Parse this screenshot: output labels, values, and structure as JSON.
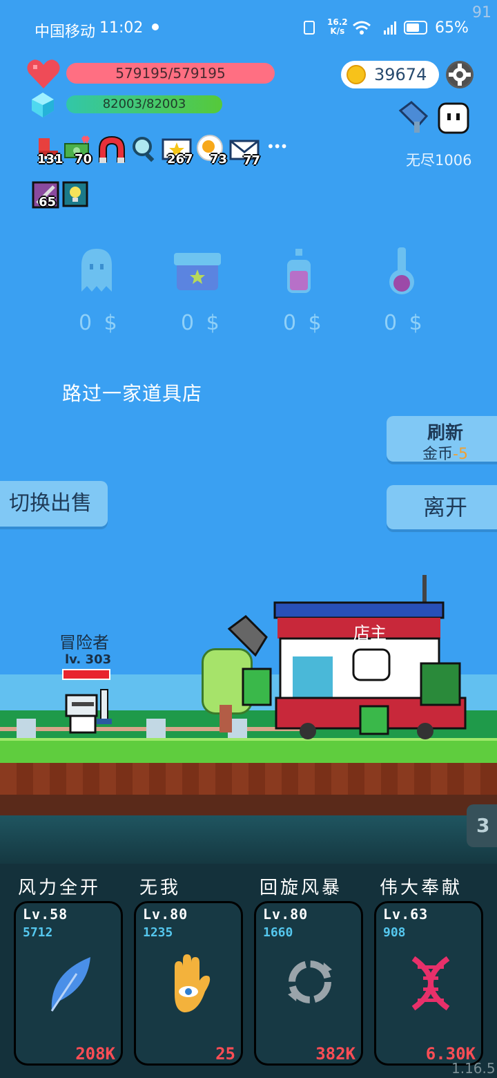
{
  "status_bar": {
    "carrier": "中国移动",
    "time": "11:02",
    "speed_top": "16.2",
    "speed_unit": "K/s",
    "battery": "65%",
    "fps": "91"
  },
  "hp": {
    "text": "579195/579195",
    "fraction": 1.0
  },
  "mp": {
    "text": "82003/82003",
    "fraction": 1.0
  },
  "gold": "39674",
  "endless_label": "无尽1006",
  "buffs": [
    {
      "icon": "boot-icon",
      "count": "131"
    },
    {
      "icon": "money-heart-icon",
      "count": "70"
    },
    {
      "icon": "magnet-icon",
      "count": ""
    },
    {
      "icon": "magnifier-icon",
      "count": ""
    },
    {
      "icon": "star-card-icon",
      "count": "267"
    },
    {
      "icon": "egg-icon",
      "count": "73"
    },
    {
      "icon": "mail-icon",
      "count": "77"
    }
  ],
  "buffs_more": "•••",
  "buffs_row2": [
    {
      "icon": "sword-card-icon",
      "count": "65"
    },
    {
      "icon": "lightbulb-card-icon",
      "count": ""
    }
  ],
  "shop_items": [
    {
      "icon": "ghost-icon",
      "price": "0 $"
    },
    {
      "icon": "box-icon",
      "price": "0 $"
    },
    {
      "icon": "spray-bottle-icon",
      "price": "0 $"
    },
    {
      "icon": "flask-icon",
      "price": "0 $"
    }
  ],
  "event_text": "路过一家道具店",
  "refresh": {
    "label": "刷新",
    "cost_label": "金币",
    "cost": "-5"
  },
  "leave_label": "离开",
  "switch_sell_label": "切换出售",
  "player": {
    "name": "冒险者",
    "level": "lv. 303"
  },
  "shopkeeper_label": "店主",
  "page_badge": "3",
  "skills": [
    {
      "title": "风力全开",
      "level": "Lv.58",
      "value": "5712",
      "cost": "208K",
      "icon": "feather-icon",
      "color": "#4a8fe8"
    },
    {
      "title": "无我",
      "level": "Lv.80",
      "value": "1235",
      "cost": "25",
      "icon": "eye-hand-icon",
      "color": "#f3b23c"
    },
    {
      "title": "回旋风暴",
      "level": "Lv.80",
      "value": "1660",
      "cost": "382K",
      "icon": "cycle-icon",
      "color": "#9aa4aa"
    },
    {
      "title": "伟大奉献",
      "level": "Lv.63",
      "value": "908",
      "cost": "6.30K",
      "icon": "dna-icon",
      "color": "#e8306a"
    }
  ],
  "version": "1.16.5"
}
